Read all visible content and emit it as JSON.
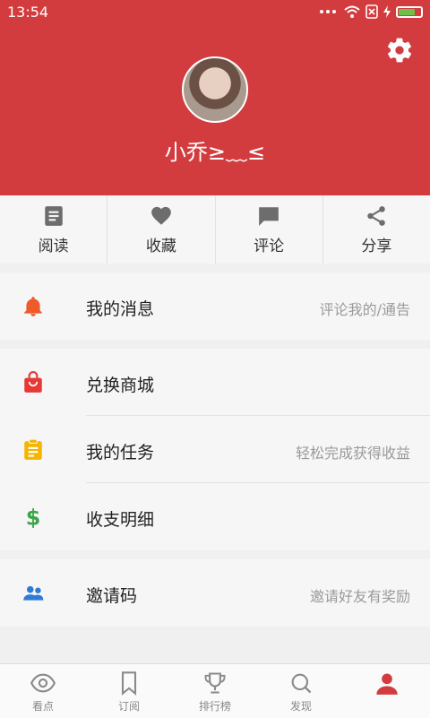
{
  "status_bar": {
    "time": "13:54"
  },
  "profile": {
    "username": "小乔≥﹏≤"
  },
  "quick_tabs": [
    {
      "label": "阅读",
      "icon": "article-icon"
    },
    {
      "label": "收藏",
      "icon": "heart-icon"
    },
    {
      "label": "评论",
      "icon": "comment-icon"
    },
    {
      "label": "分享",
      "icon": "share-icon"
    }
  ],
  "menu": {
    "messages": {
      "title": "我的消息",
      "hint": "评论我的/通告",
      "icon": "bell-icon"
    },
    "shop": {
      "title": "兑换商城",
      "icon": "shopping-bag-icon"
    },
    "tasks": {
      "title": "我的任务",
      "hint": "轻松完成获得收益",
      "icon": "clipboard-icon"
    },
    "finance": {
      "title": "收支明细",
      "icon": "dollar-icon"
    },
    "invite": {
      "title": "邀请码",
      "hint": "邀请好友有奖励",
      "icon": "people-icon"
    }
  },
  "bottom_nav": [
    {
      "label": "看点",
      "icon": "eye-icon"
    },
    {
      "label": "订阅",
      "icon": "bookmark-icon"
    },
    {
      "label": "排行榜",
      "icon": "trophy-icon"
    },
    {
      "label": "发现",
      "icon": "search-icon"
    },
    {
      "label": "",
      "icon": "profile-icon"
    }
  ],
  "colors": {
    "header_red": "#d23c3e",
    "bell": "#ef5a2a",
    "bag": "#e53935",
    "clipboard": "#f5b400",
    "dollar": "#3aa64a",
    "people": "#2e7bd6"
  }
}
